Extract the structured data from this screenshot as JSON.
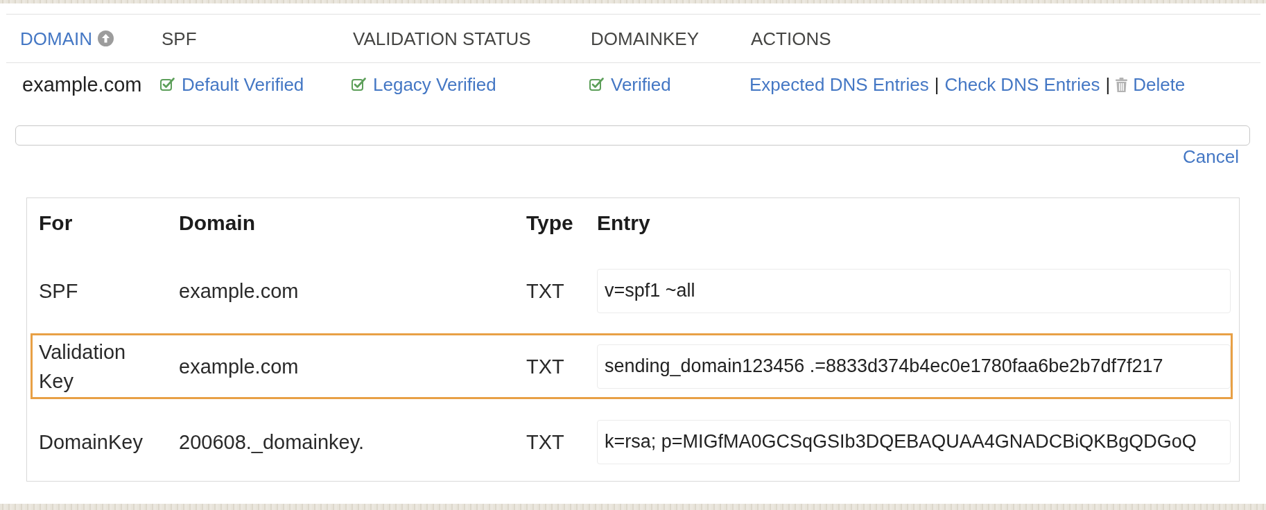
{
  "domains_table": {
    "columns": [
      {
        "label": "DOMAIN",
        "sorted": true
      },
      {
        "label": "SPF",
        "sorted": false
      },
      {
        "label": "VALIDATION STATUS",
        "sorted": false
      },
      {
        "label": "DOMAINKEY",
        "sorted": false
      },
      {
        "label": "ACTIONS",
        "sorted": false
      }
    ],
    "rows": [
      {
        "domain": "example.com",
        "spf": {
          "label": "Default Verified",
          "verified": true
        },
        "validation_status": {
          "label": "Legacy Verified",
          "verified": true
        },
        "domainkey": {
          "label": "Verified",
          "verified": true
        },
        "actions": [
          {
            "kind": "link",
            "label": "Expected DNS Entries"
          },
          {
            "kind": "separator",
            "label": "|"
          },
          {
            "kind": "link",
            "label": "Check DNS Entries"
          },
          {
            "kind": "separator",
            "label": "|"
          },
          {
            "kind": "delete",
            "label": "Delete"
          }
        ]
      }
    ]
  },
  "cancel_link": "Cancel",
  "dns_entries_table": {
    "columns": [
      "For",
      "Domain",
      "Type",
      "Entry"
    ],
    "rows": [
      {
        "for": "SPF",
        "domain": "example.com",
        "type": "TXT",
        "entry": "v=spf1 ~all",
        "highlighted": false
      },
      {
        "for": "Validation Key",
        "domain": "example.com",
        "type": "TXT",
        "entry": "sending_domain123456 .=8833d374b4ec0e1780faa6be2b7df7f217",
        "highlighted": true
      },
      {
        "for": "DomainKey",
        "domain": "200608._domainkey.",
        "type": "TXT",
        "entry": "k=rsa; p=MIGfMA0GCSqGSIb3DQEBAQUAA4GNADCBiQKBgQDGoQ",
        "highlighted": false
      }
    ]
  }
}
